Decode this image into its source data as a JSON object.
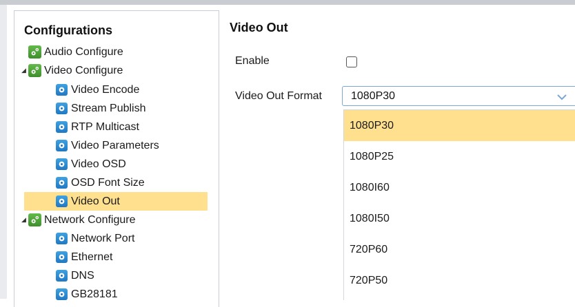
{
  "tree": {
    "title": "Configurations",
    "nodes": [
      {
        "label": "Audio Configure",
        "kind": "group",
        "expanded": false
      },
      {
        "label": "Video Configure",
        "kind": "group",
        "expanded": true
      },
      {
        "label": "Video Encode",
        "kind": "leaf"
      },
      {
        "label": "Stream Publish",
        "kind": "leaf"
      },
      {
        "label": "RTP Multicast",
        "kind": "leaf"
      },
      {
        "label": "Video Parameters",
        "kind": "leaf"
      },
      {
        "label": "Video OSD",
        "kind": "leaf"
      },
      {
        "label": "OSD Font Size",
        "kind": "leaf"
      },
      {
        "label": "Video Out",
        "kind": "leaf",
        "selected": true
      },
      {
        "label": "Network Configure",
        "kind": "group",
        "expanded": true
      },
      {
        "label": "Network Port",
        "kind": "leaf"
      },
      {
        "label": "Ethernet",
        "kind": "leaf"
      },
      {
        "label": "DNS",
        "kind": "leaf"
      },
      {
        "label": "GB28181",
        "kind": "leaf"
      }
    ],
    "group_icon": "gear-group-icon",
    "leaf_icon": "gear-leaf-icon",
    "expander_icon": "triangle-expand-icon"
  },
  "main": {
    "title": "Video Out",
    "enable_label": "Enable",
    "enable_checked": false,
    "format_label": "Video Out Format",
    "format_value": "1080P30",
    "format_options": [
      "1080P30",
      "1080P25",
      "1080I60",
      "1080I50",
      "720P60",
      "720P50"
    ],
    "highlighted_option": "1080P30"
  },
  "colors": {
    "selection": "#ffe08f",
    "select_border": "#7aa7d8",
    "group_icon": "#4fa83a",
    "leaf_icon": "#2a8ad4"
  }
}
